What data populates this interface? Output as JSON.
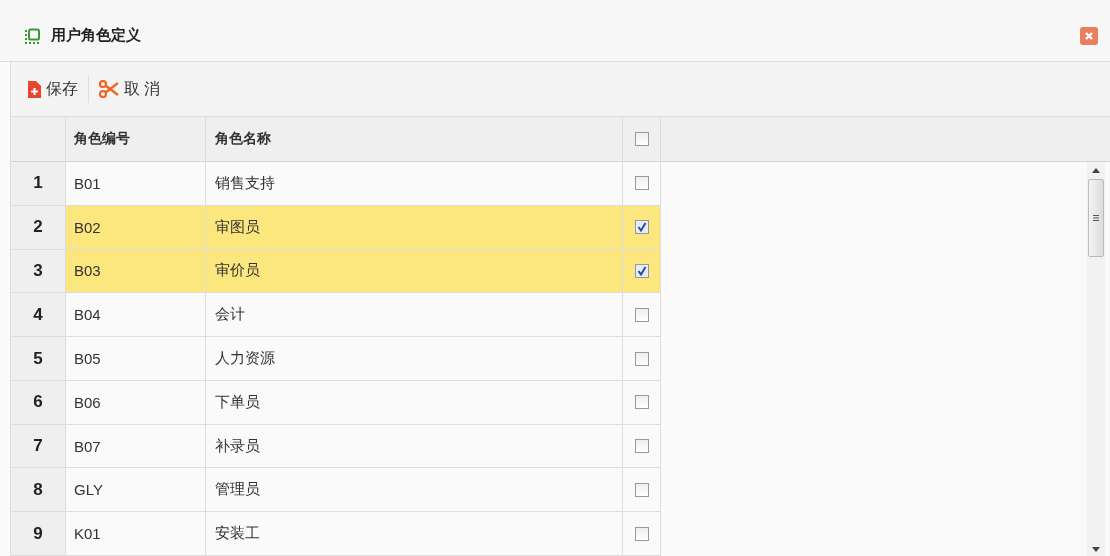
{
  "window": {
    "title": "用户角色定义"
  },
  "toolbar": [
    {
      "kind": "save",
      "label": "保存"
    },
    {
      "kind": "cancel",
      "label": "取 消"
    }
  ],
  "table": {
    "columns": [
      "角色编号",
      "角色名称"
    ],
    "header_checked": false,
    "rows": [
      {
        "index": "1",
        "code": "B01",
        "name": "销售支持",
        "selected": false
      },
      {
        "index": "2",
        "code": "B02",
        "name": "审图员",
        "selected": true
      },
      {
        "index": "3",
        "code": "B03",
        "name": "审价员",
        "selected": true
      },
      {
        "index": "4",
        "code": "B04",
        "name": "会计",
        "selected": false
      },
      {
        "index": "5",
        "code": "B05",
        "name": "人力资源",
        "selected": false
      },
      {
        "index": "6",
        "code": "B06",
        "name": "下单员",
        "selected": false
      },
      {
        "index": "7",
        "code": "B07",
        "name": "补录员",
        "selected": false
      },
      {
        "index": "8",
        "code": "GLY",
        "name": "管理员",
        "selected": false
      },
      {
        "index": "9",
        "code": "K01",
        "name": "安装工",
        "selected": false
      }
    ]
  }
}
